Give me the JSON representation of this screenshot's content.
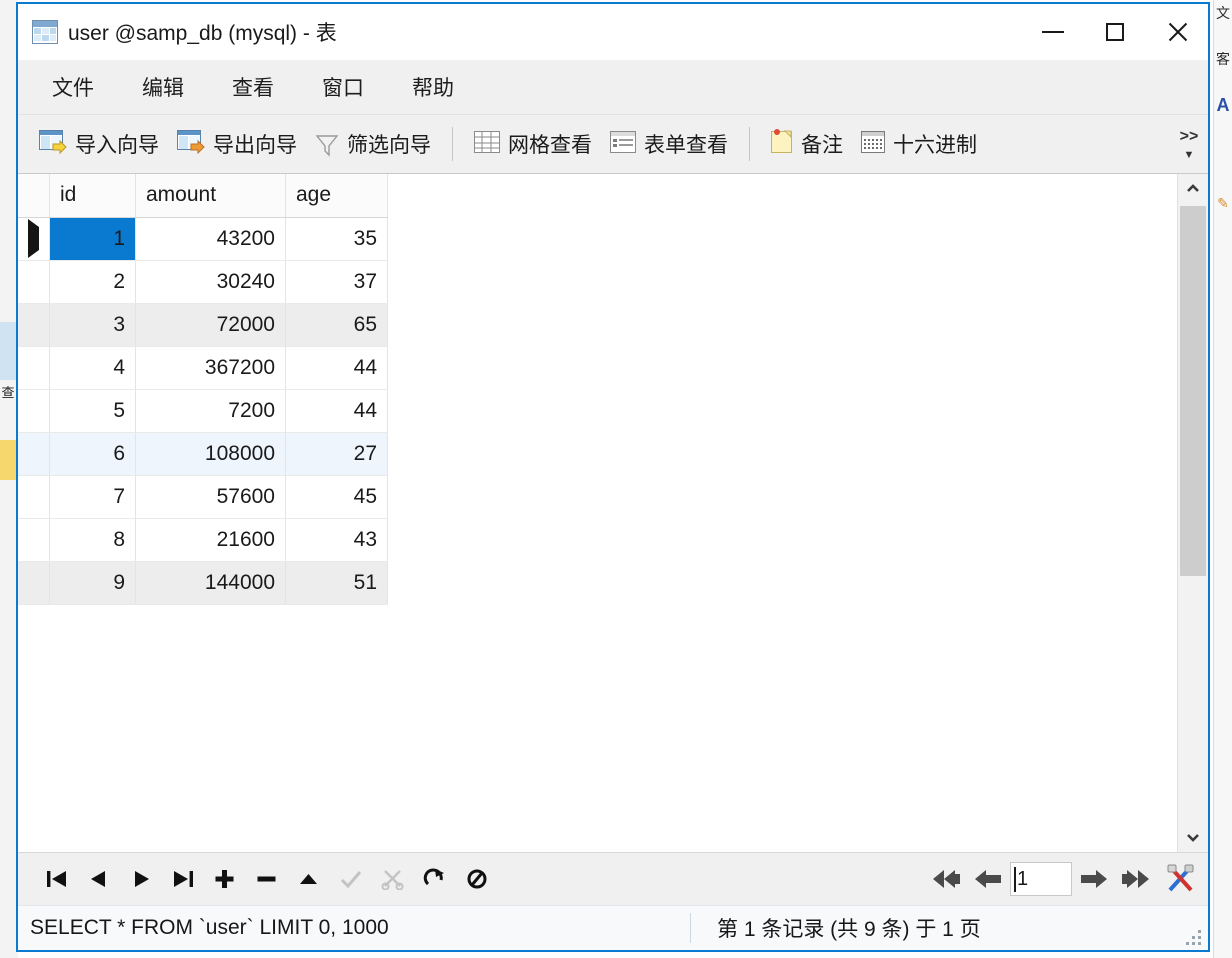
{
  "window": {
    "title": "user @samp_db (mysql) - 表",
    "title_icon": "table-icon",
    "controls": {
      "minimize": "minimize-icon",
      "maximize": "maximize-icon",
      "close": "close-icon"
    }
  },
  "menubar": {
    "items": [
      {
        "label": "文件"
      },
      {
        "label": "编辑"
      },
      {
        "label": "查看"
      },
      {
        "label": "窗口"
      },
      {
        "label": "帮助"
      }
    ]
  },
  "toolbar": {
    "buttons": [
      {
        "label": "导入向导",
        "icon": "import-wizard-icon"
      },
      {
        "label": "导出向导",
        "icon": "export-wizard-icon"
      },
      {
        "label": "筛选向导",
        "icon": "filter-funnel-icon"
      },
      {
        "label": "网格查看",
        "icon": "grid-view-icon"
      },
      {
        "label": "表单查看",
        "icon": "form-view-icon"
      },
      {
        "label": "备注",
        "icon": "note-icon"
      },
      {
        "label": "十六进制",
        "icon": "hex-icon"
      }
    ],
    "overflow": ">>",
    "overflow_caret": "▼"
  },
  "grid": {
    "columns": [
      "id",
      "amount",
      "age"
    ],
    "selected_column": "id",
    "selected_row_index": 0,
    "hover_row_index": 5,
    "alt_row_indexes": [
      2,
      8
    ],
    "rows": [
      {
        "id": "1",
        "amount": "43200",
        "age": "35"
      },
      {
        "id": "2",
        "amount": "30240",
        "age": "37"
      },
      {
        "id": "3",
        "amount": "72000",
        "age": "65"
      },
      {
        "id": "4",
        "amount": "367200",
        "age": "44"
      },
      {
        "id": "5",
        "amount": "7200",
        "age": "44"
      },
      {
        "id": "6",
        "amount": "108000",
        "age": "27"
      },
      {
        "id": "7",
        "amount": "57600",
        "age": "45"
      },
      {
        "id": "8",
        "amount": "21600",
        "age": "43"
      },
      {
        "id": "9",
        "amount": "144000",
        "age": "51"
      }
    ],
    "scrollbar": {
      "up_arrow": "˄",
      "down_arrow": "˅"
    }
  },
  "navbar": {
    "buttons": [
      {
        "name": "first-record",
        "glyph": "⏮",
        "enabled": true
      },
      {
        "name": "prev-record",
        "glyph": "◀",
        "enabled": true
      },
      {
        "name": "next-record",
        "glyph": "▶",
        "enabled": true
      },
      {
        "name": "last-record",
        "glyph": "⏭",
        "enabled": true
      },
      {
        "name": "add-record",
        "glyph": "✚",
        "enabled": true
      },
      {
        "name": "delete-record",
        "glyph": "━",
        "enabled": true
      },
      {
        "name": "move-up",
        "glyph": "▲",
        "enabled": true
      },
      {
        "name": "apply-changes",
        "glyph": "✓",
        "enabled": false
      },
      {
        "name": "cancel-changes",
        "glyph": "✄",
        "enabled": false
      },
      {
        "name": "refresh",
        "glyph": "↻",
        "enabled": true
      },
      {
        "name": "stop",
        "glyph": "⊘",
        "enabled": true
      }
    ],
    "pager": {
      "first_page": "⇤",
      "prev_page": "⬅",
      "page_value": "1",
      "next_page": "➡",
      "last_page": "⇥",
      "tools_icon": "tools-icon"
    }
  },
  "statusbar": {
    "sql": "SELECT * FROM `user` LIMIT 0, 1000",
    "record_info": "第 1 条记录 (共 9 条) 于 1 页"
  },
  "background": {
    "right_labels": [
      "文",
      "客",
      "A",
      "✎"
    ],
    "left_labels": [
      "查"
    ]
  },
  "colors": {
    "window_border": "#0a7ad1",
    "selection": "#0a7ad1",
    "column_header_selected": "#dce9f7",
    "row_alt": "#ededed",
    "row_hover": "#eef5fd",
    "chrome": "#f0f0f0"
  }
}
